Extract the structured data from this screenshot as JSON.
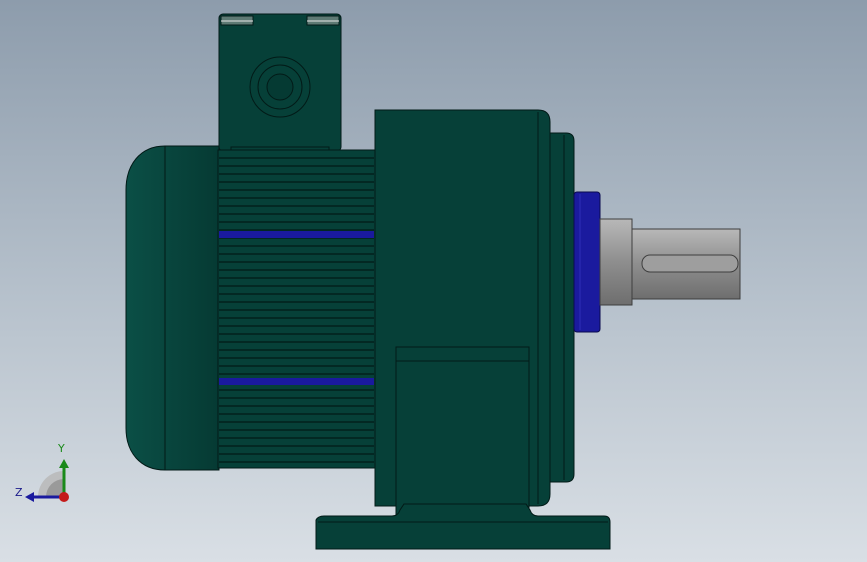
{
  "viewport": {
    "background_top": "#8d9cac",
    "background_bottom": "#d9dfe5"
  },
  "model": {
    "description_icon": "gear-motor-side-view",
    "body_color": "#064038",
    "edge_color": "#021a17",
    "ring_color": "#1a1a9e",
    "shaft_color": "#9a9a9a"
  },
  "triad": {
    "y_label": "Y",
    "z_label": "Z",
    "x_color": "#c41a1a",
    "y_color": "#1a8a1a",
    "z_color": "#1a1a9e"
  }
}
